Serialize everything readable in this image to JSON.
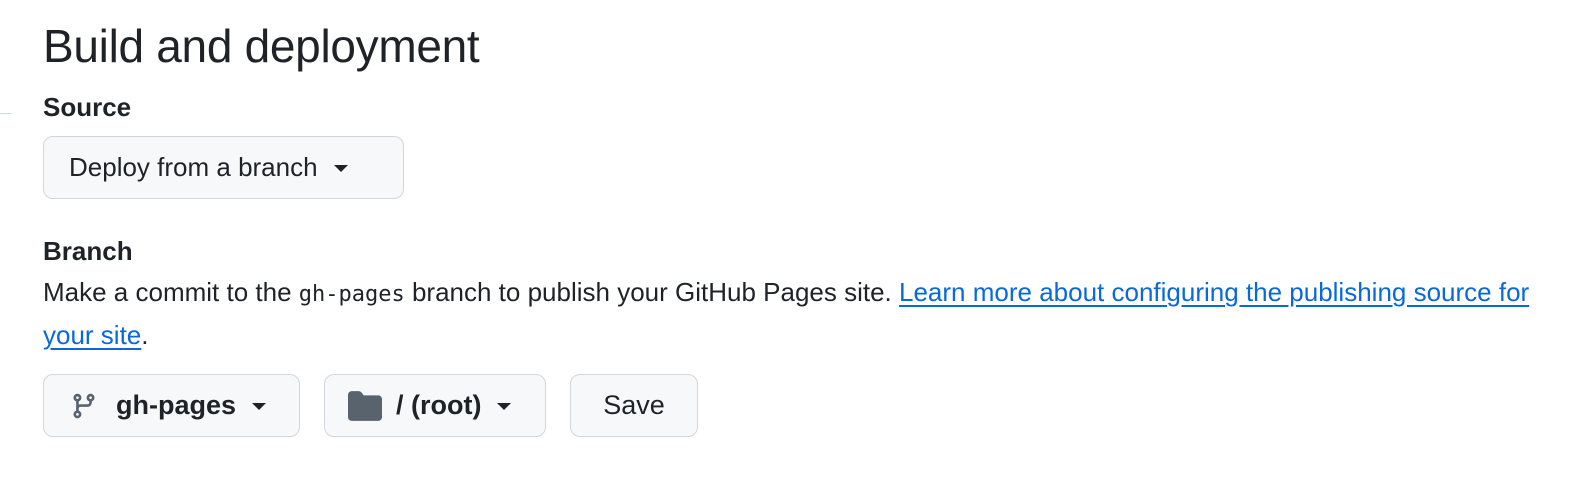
{
  "section": {
    "title": "Build and deployment"
  },
  "source": {
    "label": "Source",
    "selected": "Deploy from a branch"
  },
  "branch": {
    "label": "Branch",
    "description_before": "Make a commit to the ",
    "description_code": "gh-pages",
    "description_after": " branch to publish your GitHub Pages site. ",
    "link_text": "Learn more about configuring the publishing source for your site",
    "description_end": ".",
    "branch_selected": "gh-pages",
    "folder_selected": "/ (root)",
    "save_label": "Save",
    "icons": {
      "branch": "git-branch-icon",
      "folder": "folder-icon"
    }
  },
  "colors": {
    "link": "#0969da",
    "button_bg": "#f6f8fa",
    "button_border": "#d0d7de",
    "text": "#1f2328",
    "icon_muted": "#59636e"
  }
}
